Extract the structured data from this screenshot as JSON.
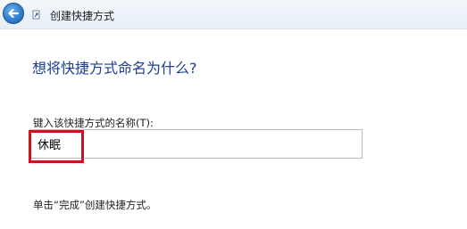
{
  "window": {
    "title": "创建快捷方式"
  },
  "icons": {
    "back": "back-arrow-icon",
    "wizard": "shortcut-icon"
  },
  "colors": {
    "heading": "#1e3f8f",
    "highlight": "#c4161c",
    "back_button": "#2f7fcf"
  },
  "main": {
    "heading": "想将快捷方式命名为什么?",
    "name_label": "键入该快捷方式的名称(T):",
    "name_value": "休眠",
    "instruction": "单击“完成”创建快捷方式。"
  }
}
